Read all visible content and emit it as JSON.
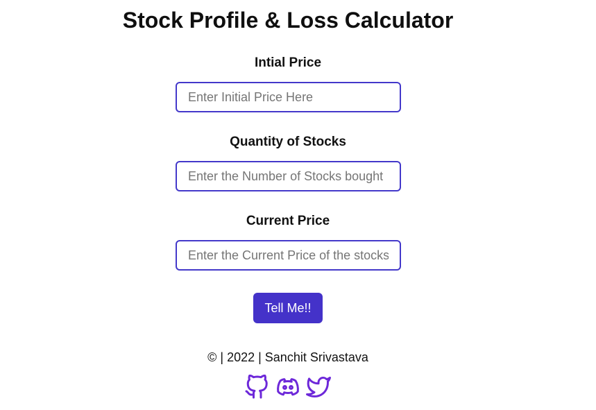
{
  "header": {
    "title": "Stock Profile & Loss Calculator"
  },
  "form": {
    "initial_price": {
      "label": "Intial Price",
      "placeholder": "Enter Initial Price Here",
      "value": ""
    },
    "quantity": {
      "label": "Quantity of Stocks",
      "placeholder": "Enter the Number of Stocks bought",
      "value": ""
    },
    "current_price": {
      "label": "Current Price",
      "placeholder": "Enter the Current Price of the stocks",
      "value": ""
    },
    "submit_label": "Tell Me!!"
  },
  "footer": {
    "text": "© | 2022 | Sanchit Srivastava",
    "links": [
      {
        "icon": "github-icon"
      },
      {
        "icon": "discord-icon"
      },
      {
        "icon": "twitter-icon"
      }
    ]
  },
  "colors": {
    "accent": "#4432c9",
    "input_border": "#4338ca",
    "icon": "#6d28d9"
  }
}
